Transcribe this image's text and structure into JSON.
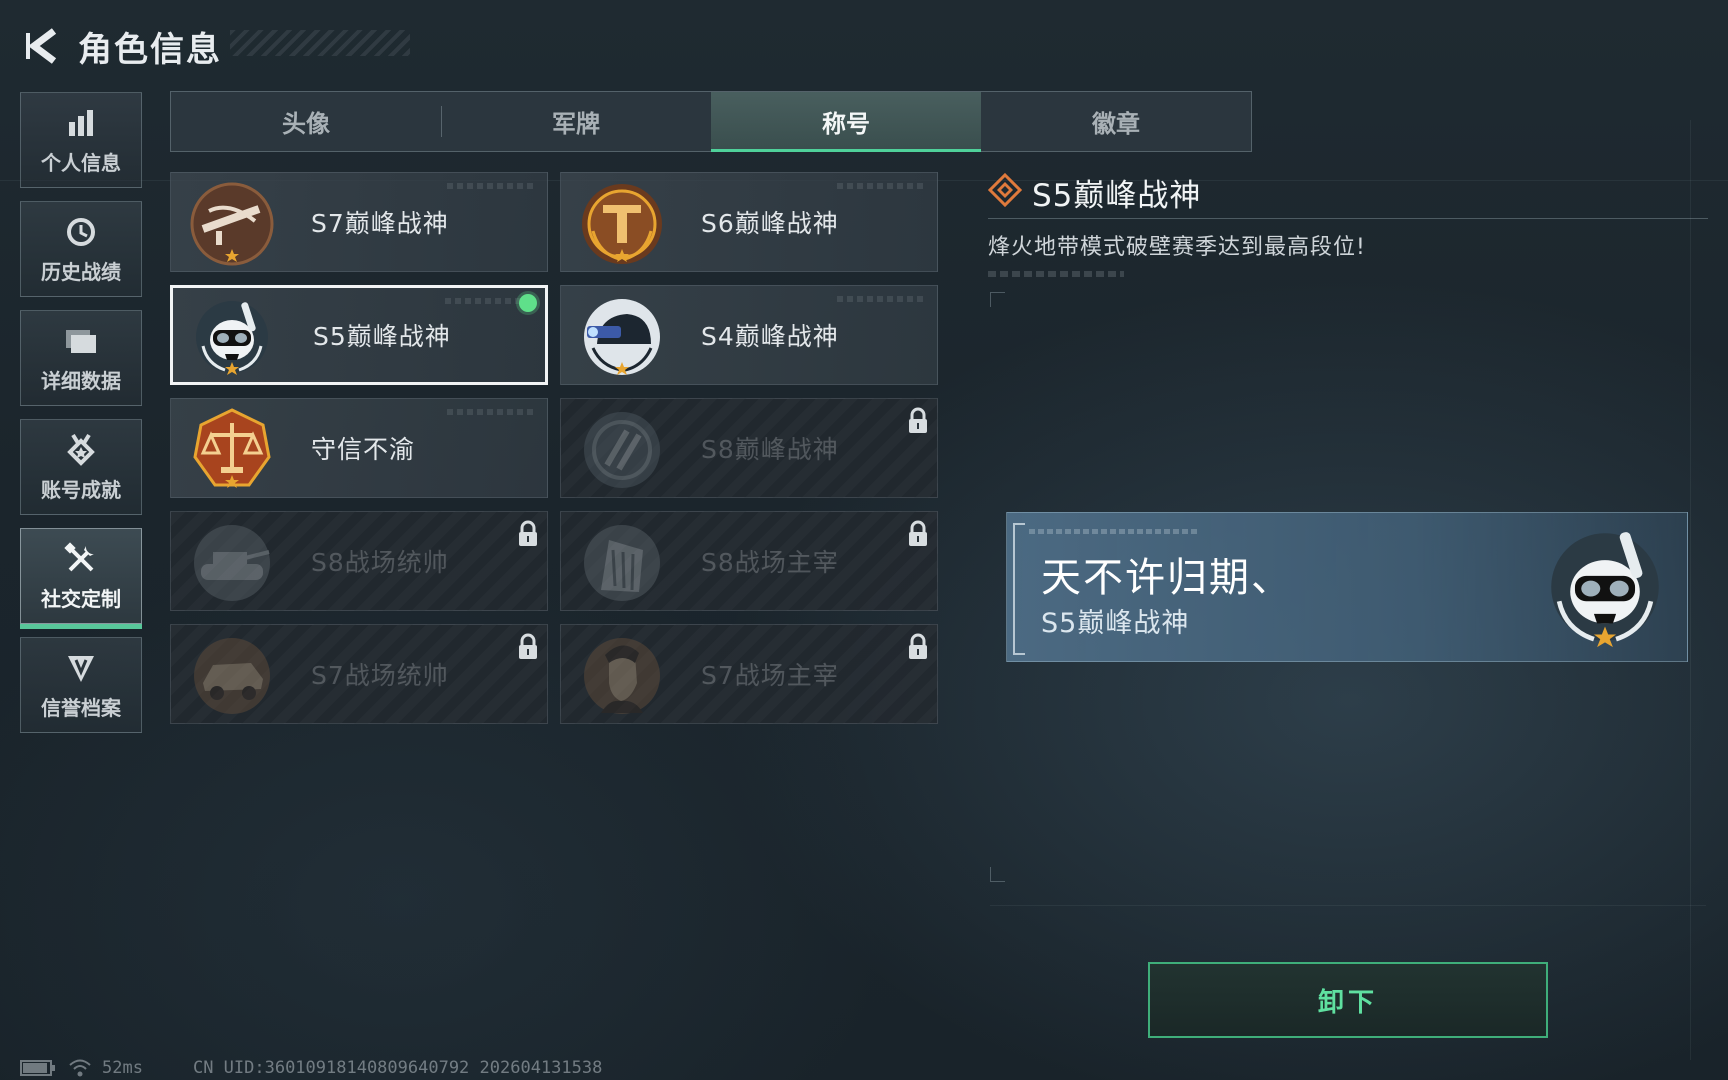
{
  "header": {
    "title": "角色信息"
  },
  "side_nav": [
    {
      "label": "个人信息",
      "icon": "bar-chart-icon",
      "active": false
    },
    {
      "label": "历史战绩",
      "icon": "history-clock-icon",
      "active": false
    },
    {
      "label": "详细数据",
      "icon": "folder-icon",
      "active": false
    },
    {
      "label": "账号成就",
      "icon": "medal-icon",
      "active": false
    },
    {
      "label": "社交定制",
      "icon": "tools-icon",
      "active": true
    },
    {
      "label": "信誉档案",
      "icon": "shield-credit-icon",
      "active": false
    }
  ],
  "tabs": [
    {
      "label": "头像",
      "active": false
    },
    {
      "label": "军牌",
      "active": false
    },
    {
      "label": "称号",
      "active": true
    },
    {
      "label": "徽章",
      "active": false
    }
  ],
  "titles": [
    {
      "label": "S7巅峰战神",
      "emblem": "crossbow-emblem-icon",
      "locked": false,
      "selected": false
    },
    {
      "label": "S6巅峰战神",
      "emblem": "shield-t-emblem-icon",
      "locked": false,
      "selected": false
    },
    {
      "label": "S5巅峰战神",
      "emblem": "diver-skull-emblem-icon",
      "locked": false,
      "selected": true,
      "equipped": true
    },
    {
      "label": "S4巅峰战神",
      "emblem": "helmet-nvg-emblem-icon",
      "locked": false,
      "selected": false
    },
    {
      "label": "守信不渝",
      "emblem": "scales-emblem-icon",
      "locked": false,
      "selected": false
    },
    {
      "label": "S8巅峰战神",
      "emblem": "slash-emblem-icon",
      "locked": true,
      "selected": false
    },
    {
      "label": "S8战场统帅",
      "emblem": "tank-emblem-icon",
      "locked": true,
      "selected": false
    },
    {
      "label": "S8战场主宰",
      "emblem": "building-emblem-icon",
      "locked": true,
      "selected": false
    },
    {
      "label": "S7战场统帅",
      "emblem": "vehicle-emblem-icon",
      "locked": true,
      "selected": false
    },
    {
      "label": "S7战场主宰",
      "emblem": "soldier-portrait-emblem-icon",
      "locked": true,
      "selected": false
    }
  ],
  "detail": {
    "name": "S5巅峰战神",
    "description": "烽火地带模式破壁赛季达到最高段位!"
  },
  "preview": {
    "player_name": "天不许归期、",
    "title": "S5巅峰战神"
  },
  "actions": {
    "unequip_label": "卸下"
  },
  "status_bar": {
    "ping": "52ms",
    "uid": "CN UID:36010918140809640792 202604131538"
  },
  "colors": {
    "accent_green": "#4fd19a",
    "equipped_dot": "#5fe08a",
    "background": "#1c262d"
  }
}
